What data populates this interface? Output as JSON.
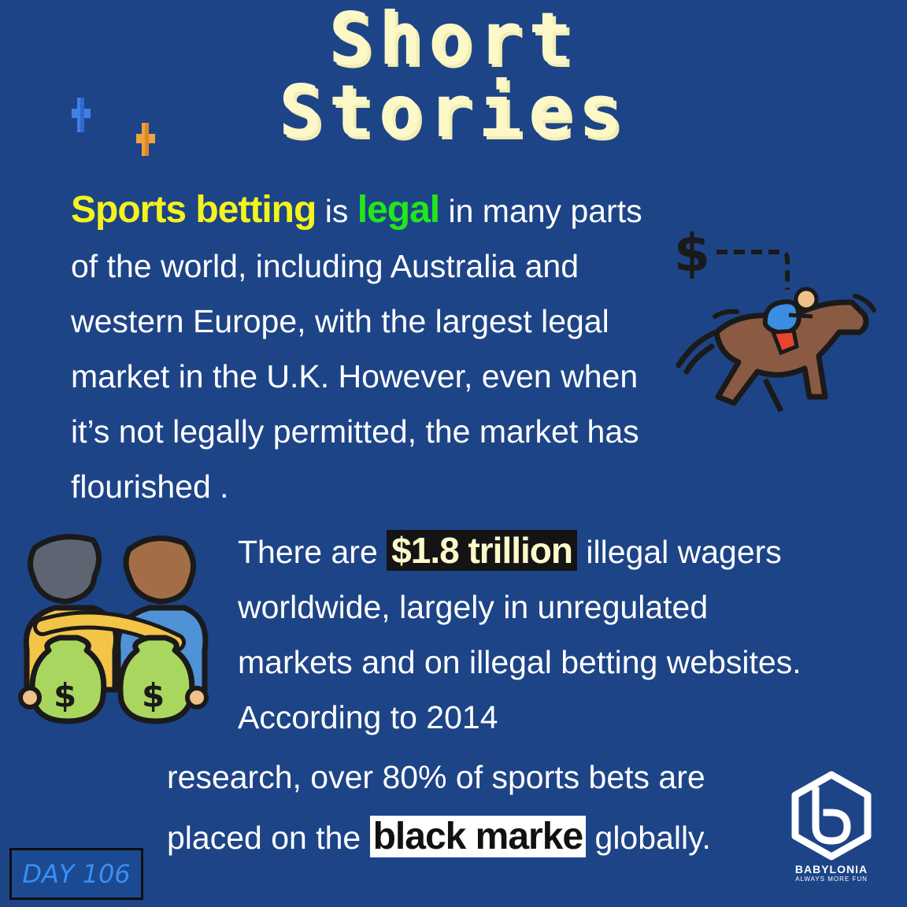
{
  "title": {
    "line1": "Short",
    "line2": "Stories"
  },
  "paragraph1": {
    "hl1": "Sports betting",
    "t1": " is ",
    "hl2": "legal",
    "t2": " in many parts of the world, including Australia and western Europe, with the largest legal market in the U.K. However, even when it’s not legally permitted, the market has flourished ."
  },
  "paragraph2": {
    "t1": "There are ",
    "hl": "$1.8 trillion",
    "t2": " illegal wagers worldwide, largely in unregulated markets and on illegal betting websites. According to 2014"
  },
  "paragraph3": {
    "t1": "research, over 80% of sports bets are",
    "t2": "placed on the ",
    "hl": "black marke",
    "t3": " globally."
  },
  "day_badge": "DAY 106",
  "logo": {
    "name": "BABYLONIA",
    "tagline": "ALWAYS MORE FUN"
  },
  "icons": {
    "sparkle_blue": "sparkle-icon",
    "sparkle_orange": "sparkle-icon",
    "horse": "horse-racing-icon",
    "money": "money-bags-icon"
  },
  "colors": {
    "background": "#1d4487",
    "title": "#fcf8c8",
    "highlight_yellow": "#f4f41c",
    "highlight_green": "#22e81a",
    "badge_text": "#3c8ef2"
  }
}
